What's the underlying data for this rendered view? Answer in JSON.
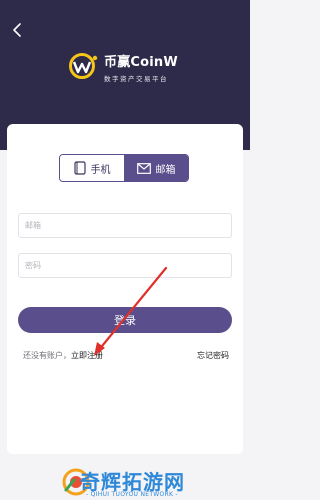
{
  "brand": {
    "name": "币赢CoinW",
    "slogan": "数字资产交易平台"
  },
  "login_tabs": [
    {
      "label": "手机",
      "icon": "phone-icon",
      "active": false
    },
    {
      "label": "邮箱",
      "icon": "mail-icon",
      "active": true
    }
  ],
  "form": {
    "email_placeholder": "邮箱",
    "password_placeholder": "密码",
    "login_label": "登录"
  },
  "footer_links": {
    "no_account_text": "还没有账户，",
    "register_label": "立即注册",
    "forgot_label": "忘记密码"
  },
  "watermark": {
    "title": "奇辉拓游网",
    "subtitle": "- QIHUI TUOYOU NETWORK -"
  },
  "colors": {
    "header_bg": "#2e2a4a",
    "accent": "#5a4f8c",
    "annotation_arrow": "#e0302a",
    "watermark": "#2f89d8"
  }
}
